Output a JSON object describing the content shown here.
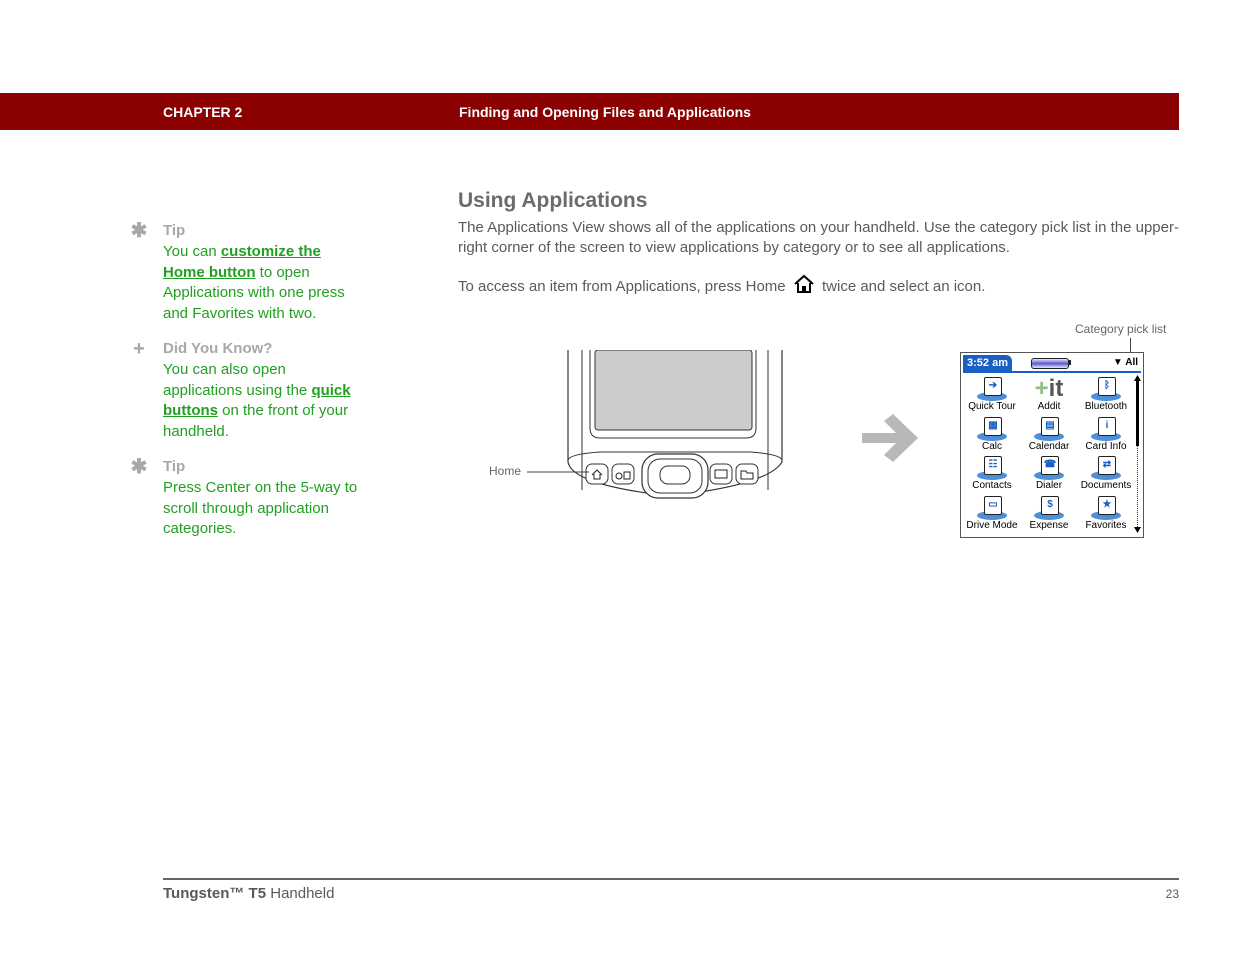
{
  "header": {
    "chapter": "CHAPTER 2",
    "title": "Finding and Opening Files and Applications",
    "color": "#8b0000"
  },
  "sidebar": {
    "blocks": [
      {
        "icon": "asterisk-icon",
        "icon_glyph": "✱",
        "heading": "Tip",
        "text_before": "You can ",
        "link": "customize the Home button",
        "text_after": " to open Applications with one press and Favorites with two."
      },
      {
        "icon": "plus-icon",
        "icon_glyph": "+",
        "heading": "Did You Know?",
        "text_before": "You can also open applications using the ",
        "link": "quick buttons",
        "text_after": " on the front of your handheld."
      },
      {
        "icon": "asterisk-icon",
        "icon_glyph": "✱",
        "heading": "Tip",
        "text": "Press Center on the 5-way to scroll through application categories."
      }
    ],
    "text_color": "#22a022"
  },
  "main": {
    "heading": "Using Applications",
    "paragraph1": "The Applications View shows all of the applications on your handheld. Use the category pick list in the upper-right corner of the screen to view applications by category or to see all applications.",
    "paragraph2_before": "To access an item from Applications, press Home",
    "paragraph2_after": "twice and select an icon."
  },
  "figure": {
    "home_label": "Home",
    "category_label": "Category pick list",
    "screen": {
      "time": "3:52 am",
      "category": "All",
      "apps": [
        {
          "label": "Quick Tour",
          "glyph": "➔"
        },
        {
          "label": "Addit",
          "glyph": "+it"
        },
        {
          "label": "Bluetooth",
          "glyph": "ᛒ"
        },
        {
          "label": "Calc",
          "glyph": "▦"
        },
        {
          "label": "Calendar",
          "glyph": "▤"
        },
        {
          "label": "Card Info",
          "glyph": "i"
        },
        {
          "label": "Contacts",
          "glyph": "☷"
        },
        {
          "label": "Dialer",
          "glyph": "☎"
        },
        {
          "label": "Documents",
          "glyph": "⇄"
        },
        {
          "label": "Drive Mode",
          "glyph": "▭"
        },
        {
          "label": "Expense",
          "glyph": "$"
        },
        {
          "label": "Favorites",
          "glyph": "★"
        }
      ]
    }
  },
  "footer": {
    "product_bold": "Tungsten™ T5",
    "product_rest": " Handheld",
    "page_number": "23"
  }
}
